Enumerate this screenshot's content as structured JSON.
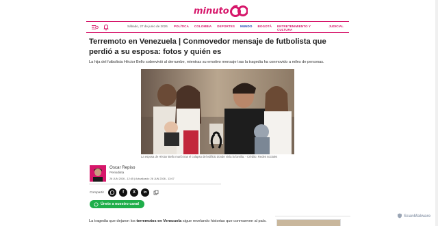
{
  "header": {
    "logo_text": "minuto",
    "logo_number": "60"
  },
  "navbar": {
    "menu_icon": "menu-search-icon",
    "bell_icon": "bell-icon",
    "date": "Sábado, 27 de junio de 2026",
    "links": [
      {
        "label": "POLÍTICA",
        "active": false
      },
      {
        "label": "COLOMBIA",
        "active": false
      },
      {
        "label": "DEPORTES",
        "active": false
      },
      {
        "label": "MUNDO",
        "active": true
      },
      {
        "label": "BOGOTÁ",
        "active": false
      },
      {
        "label": "ENTRETENIMIENTO Y CULTURA",
        "active": false
      },
      {
        "label": "JUDICIAL",
        "active": false
      }
    ]
  },
  "article": {
    "headline": "Terremoto en Venezuela | Conmovedor mensaje de futbolista que perdió a su esposa: fotos y quién es",
    "lead": "La hija del futbolista Héctor Bello sobrevivió al derrumbe, mientras su emotivo mensaje tras la tragedia ha conmovido a miles de personas.",
    "photo_caption": "La esposa de Héctor Bello murió tras el colapso del edificio donde vivía la familia. - Crédito: Redes sociales",
    "body_prefix": "La tragedia que dejaron los ",
    "body_bold": "terremotos en Venezuela",
    "body_suffix": " sigue revelando historias que conmueven al país."
  },
  "author": {
    "name": "Oscar Repiso",
    "role": "Periodista",
    "dates": "26 JUN 2026 - 12:45 | Actualizado: 26 JUN 2026 - 13:07"
  },
  "share": {
    "label": "Compartir",
    "buttons": [
      "whatsapp-icon",
      "facebook-icon",
      "x-icon",
      "linkedin-icon",
      "copy-icon"
    ]
  },
  "join_button": {
    "label": "Únete a nuestro canal"
  },
  "watermark": {
    "text": "ScanMalware"
  },
  "colors": {
    "brand": "#d6166a",
    "active_link": "#1a3fb0",
    "whatsapp": "#1fae4a"
  }
}
